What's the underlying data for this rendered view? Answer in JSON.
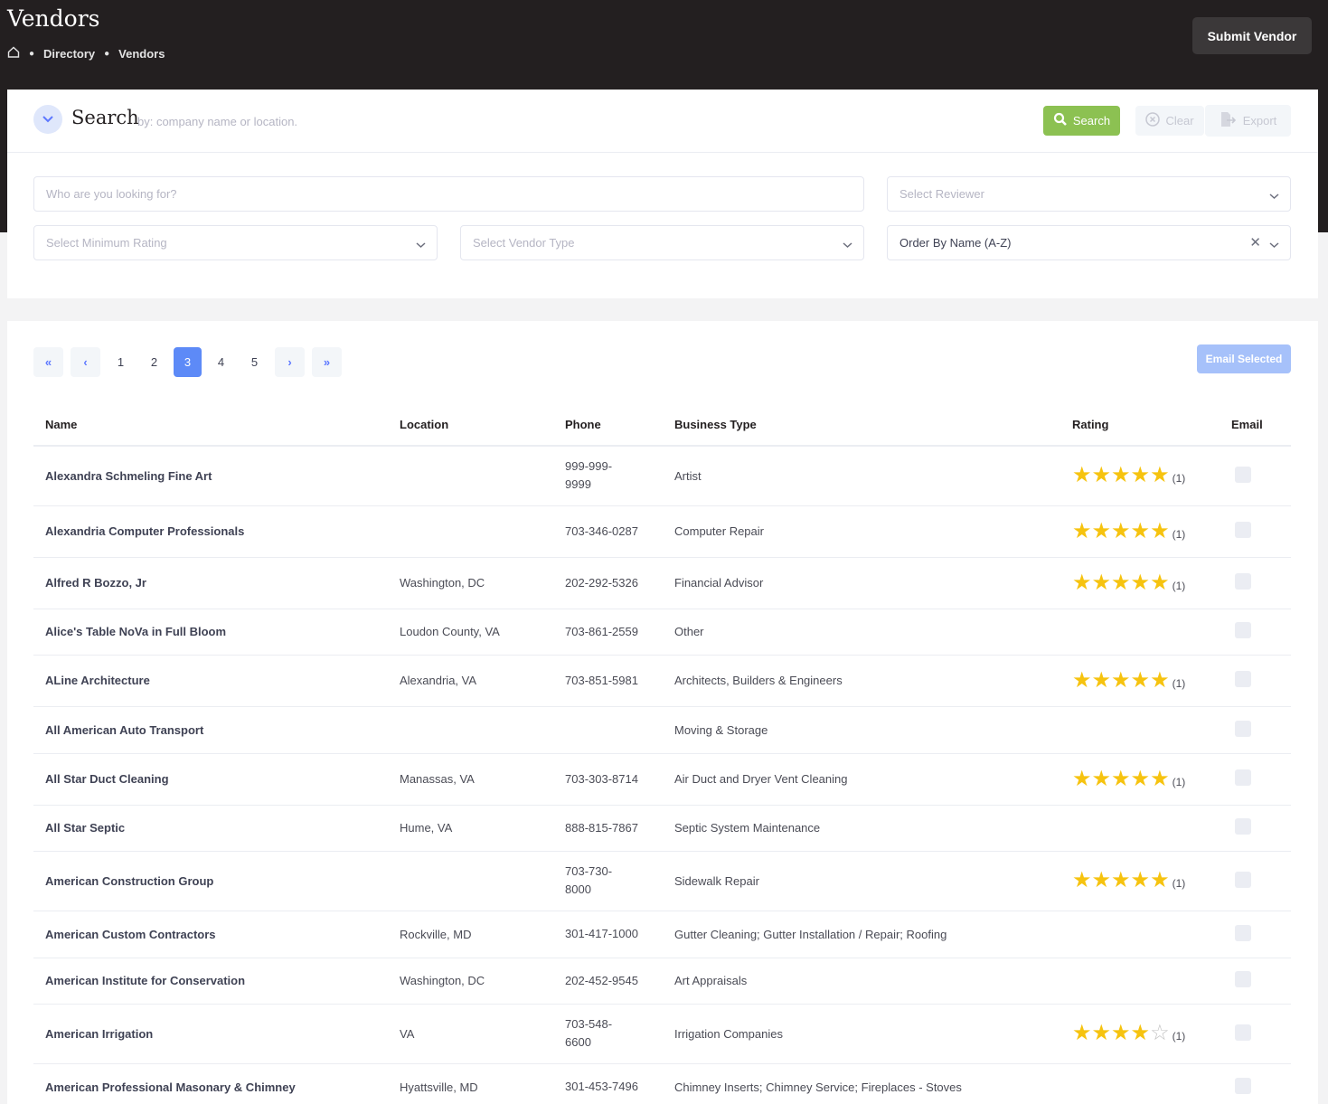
{
  "header": {
    "title": "Vendors",
    "breadcrumb": [
      "Directory",
      "Vendors"
    ],
    "submit_label": "Submit Vendor"
  },
  "search": {
    "title": "Search",
    "subtitle": "by: company name or location.",
    "search_label": "Search",
    "clear_label": "Clear",
    "export_label": "Export",
    "keyword_placeholder": "Who are you looking for?",
    "reviewer_placeholder": "Select Reviewer",
    "rating_placeholder": "Select Minimum Rating",
    "type_placeholder": "Select Vendor Type",
    "order_value": "Order By Name (A-Z)"
  },
  "pagination": {
    "pages": [
      "1",
      "2",
      "3",
      "4",
      "5"
    ],
    "current": "3",
    "email_selected_label": "Email Selected"
  },
  "table": {
    "columns": [
      "Name",
      "Location",
      "Phone",
      "Business Type",
      "Rating",
      "Email"
    ],
    "rows": [
      {
        "name": "Alexandra Schmeling Fine Art",
        "location": "",
        "phone": "999-999-\n9999",
        "type": "Artist",
        "stars": 5,
        "count": "(1)"
      },
      {
        "name": "Alexandria Computer Professionals",
        "location": "",
        "phone": "703-346-0287",
        "type": "Computer Repair",
        "stars": 5,
        "count": "(1)"
      },
      {
        "name": "Alfred R Bozzo, Jr",
        "location": "Washington, DC",
        "phone": "202-292-5326",
        "type": "Financial Advisor",
        "stars": 5,
        "count": "(1)"
      },
      {
        "name": "Alice's Table NoVa in Full Bloom",
        "location": "Loudon County, VA",
        "phone": "703-861-2559",
        "type": "Other",
        "stars": 0,
        "count": ""
      },
      {
        "name": "ALine Architecture",
        "location": "Alexandria, VA",
        "phone": "703-851-5981",
        "type": "Architects, Builders & Engineers",
        "stars": 5,
        "count": "(1)"
      },
      {
        "name": "All American Auto Transport",
        "location": "",
        "phone": "",
        "type": "Moving & Storage",
        "stars": 0,
        "count": ""
      },
      {
        "name": "All Star Duct Cleaning",
        "location": "Manassas, VA",
        "phone": "703-303-8714",
        "type": "Air Duct and Dryer Vent Cleaning",
        "stars": 5,
        "count": "(1)"
      },
      {
        "name": "All Star Septic",
        "location": "Hume, VA",
        "phone": "888-815-7867",
        "type": "Septic System Maintenance",
        "stars": 0,
        "count": ""
      },
      {
        "name": "American Construction Group",
        "location": "",
        "phone": "703-730-\n8000",
        "type": "Sidewalk Repair",
        "stars": 5,
        "count": "(1)"
      },
      {
        "name": "American Custom Contractors",
        "location": "Rockville, MD",
        "phone": "301-417-1000",
        "type": "Gutter Cleaning; Gutter Installation / Repair; Roofing",
        "stars": 0,
        "count": ""
      },
      {
        "name": "American Institute for Conservation",
        "location": "Washington, DC",
        "phone": "202-452-9545",
        "type": "Art Appraisals",
        "stars": 0,
        "count": ""
      },
      {
        "name": "American Irrigation",
        "location": "VA",
        "phone": "703-548-\n6600",
        "type": "Irrigation Companies",
        "stars": 4,
        "count": "(1)"
      },
      {
        "name": "American Professional Masonary & Chimney",
        "location": "Hyattsville, MD",
        "phone": "301-453-7496",
        "type": "Chimney Inserts; Chimney Service; Fireplaces - Stoves",
        "stars": 0,
        "count": ""
      }
    ]
  }
}
